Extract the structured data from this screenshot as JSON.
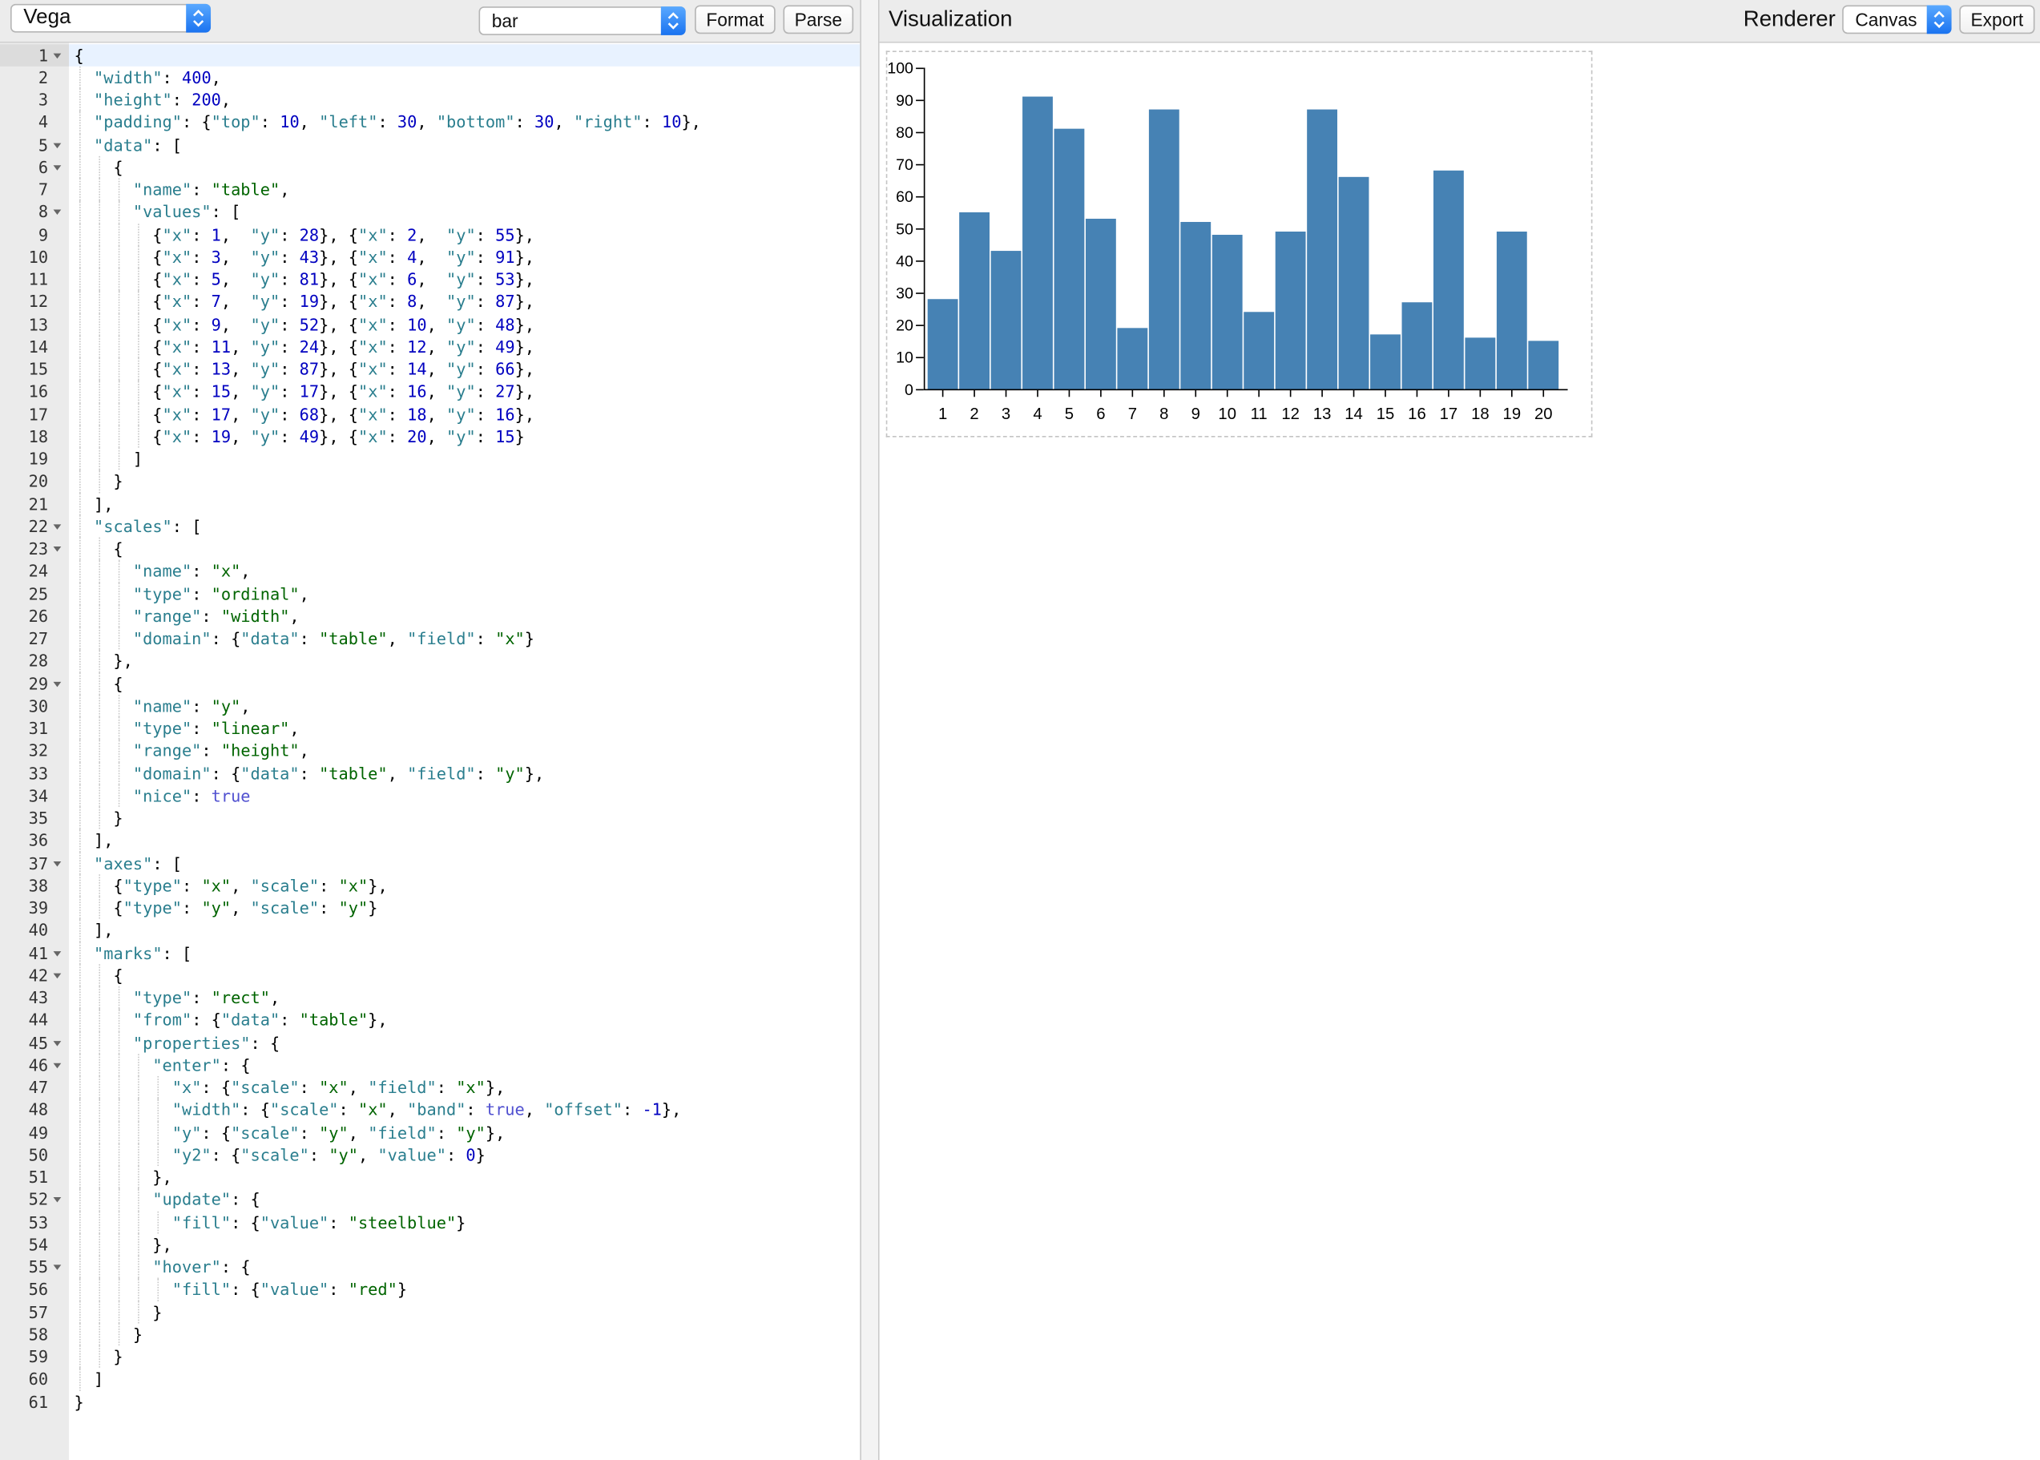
{
  "left_toolbar": {
    "mode_select": "Vega",
    "spec_select": "bar",
    "format_label": "Format",
    "parse_label": "Parse"
  },
  "editor": {
    "active_line": 1,
    "lines": [
      "{",
      "  \"width\": 400,",
      "  \"height\": 200,",
      "  \"padding\": {\"top\": 10, \"left\": 30, \"bottom\": 30, \"right\": 10},",
      "  \"data\": [",
      "    {",
      "      \"name\": \"table\",",
      "      \"values\": [",
      "        {\"x\": 1,  \"y\": 28}, {\"x\": 2,  \"y\": 55},",
      "        {\"x\": 3,  \"y\": 43}, {\"x\": 4,  \"y\": 91},",
      "        {\"x\": 5,  \"y\": 81}, {\"x\": 6,  \"y\": 53},",
      "        {\"x\": 7,  \"y\": 19}, {\"x\": 8,  \"y\": 87},",
      "        {\"x\": 9,  \"y\": 52}, {\"x\": 10, \"y\": 48},",
      "        {\"x\": 11, \"y\": 24}, {\"x\": 12, \"y\": 49},",
      "        {\"x\": 13, \"y\": 87}, {\"x\": 14, \"y\": 66},",
      "        {\"x\": 15, \"y\": 17}, {\"x\": 16, \"y\": 27},",
      "        {\"x\": 17, \"y\": 68}, {\"x\": 18, \"y\": 16},",
      "        {\"x\": 19, \"y\": 49}, {\"x\": 20, \"y\": 15}",
      "      ]",
      "    }",
      "  ],",
      "  \"scales\": [",
      "    {",
      "      \"name\": \"x\",",
      "      \"type\": \"ordinal\",",
      "      \"range\": \"width\",",
      "      \"domain\": {\"data\": \"table\", \"field\": \"x\"}",
      "    },",
      "    {",
      "      \"name\": \"y\",",
      "      \"type\": \"linear\",",
      "      \"range\": \"height\",",
      "      \"domain\": {\"data\": \"table\", \"field\": \"y\"},",
      "      \"nice\": true",
      "    }",
      "  ],",
      "  \"axes\": [",
      "    {\"type\": \"x\", \"scale\": \"x\"},",
      "    {\"type\": \"y\", \"scale\": \"y\"}",
      "  ],",
      "  \"marks\": [",
      "    {",
      "      \"type\": \"rect\",",
      "      \"from\": {\"data\": \"table\"},",
      "      \"properties\": {",
      "        \"enter\": {",
      "          \"x\": {\"scale\": \"x\", \"field\": \"x\"},",
      "          \"width\": {\"scale\": \"x\", \"band\": true, \"offset\": -1},",
      "          \"y\": {\"scale\": \"y\", \"field\": \"y\"},",
      "          \"y2\": {\"scale\": \"y\", \"value\": 0}",
      "        },",
      "        \"update\": {",
      "          \"fill\": {\"value\": \"steelblue\"}",
      "        },",
      "        \"hover\": {",
      "          \"fill\": {\"value\": \"red\"}",
      "        }",
      "      }",
      "    }",
      "  ]",
      "}"
    ],
    "fold_lines": [
      1,
      5,
      6,
      8,
      22,
      23,
      29,
      37,
      41,
      42,
      45,
      46,
      52,
      55
    ]
  },
  "right_toolbar": {
    "title": "Visualization",
    "renderer_label": "Renderer",
    "renderer_select": "Canvas",
    "export_label": "Export"
  },
  "colors": {
    "bar_fill": "#4682b4",
    "select_arrow": "#1a73f0",
    "key": "#2a7e8e",
    "string": "#006400",
    "number": "#0000c0",
    "boolean": "#5050d0"
  },
  "chart_data": {
    "type": "bar",
    "categories": [
      "1",
      "2",
      "3",
      "4",
      "5",
      "6",
      "7",
      "8",
      "9",
      "10",
      "11",
      "12",
      "13",
      "14",
      "15",
      "16",
      "17",
      "18",
      "19",
      "20"
    ],
    "values": [
      28,
      55,
      43,
      91,
      81,
      53,
      19,
      87,
      52,
      48,
      24,
      49,
      87,
      66,
      17,
      27,
      68,
      16,
      49,
      15
    ],
    "ylim": [
      0,
      100
    ],
    "yticks": [
      0,
      10,
      20,
      30,
      40,
      50,
      60,
      70,
      80,
      90,
      100
    ],
    "title": "",
    "xlabel": "",
    "ylabel": "",
    "grid": false,
    "fill": "#4682b4"
  }
}
